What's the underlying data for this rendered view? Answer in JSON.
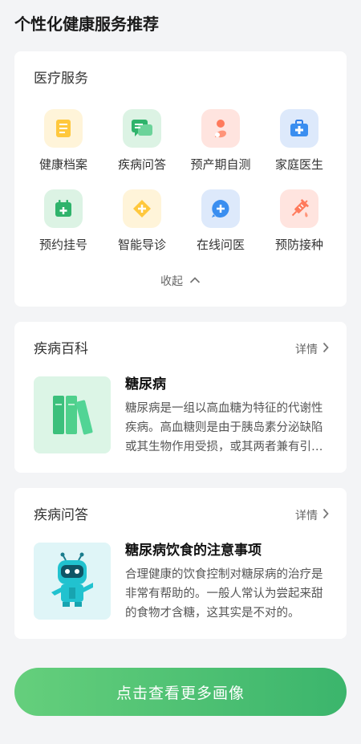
{
  "page": {
    "title": "个性化健康服务推荐"
  },
  "services": {
    "title": "医疗服务",
    "items": [
      {
        "label": "健康档案",
        "icon": "health-record-icon",
        "bg": "#fff4d9"
      },
      {
        "label": "疾病问答",
        "icon": "disease-qa-icon",
        "bg": "#dcf3e4"
      },
      {
        "label": "预产期自测",
        "icon": "due-date-icon",
        "bg": "#ffe4df"
      },
      {
        "label": "家庭医生",
        "icon": "family-doctor-icon",
        "bg": "#dde9fb"
      },
      {
        "label": "预约挂号",
        "icon": "appointment-icon",
        "bg": "#dcf3e4"
      },
      {
        "label": "智能导诊",
        "icon": "smart-guide-icon",
        "bg": "#fff4d9"
      },
      {
        "label": "在线问医",
        "icon": "online-consult-icon",
        "bg": "#dde9fb"
      },
      {
        "label": "预防接种",
        "icon": "vaccine-icon",
        "bg": "#ffe4df"
      }
    ],
    "collapse_label": "收起"
  },
  "baike": {
    "title": "疾病百科",
    "detail": "详情",
    "article_title": "糖尿病",
    "article_desc": "糖尿病是一组以高血糖为特征的代谢性疾病。高血糖则是由于胰岛素分泌缺陷或其生物作用受损，或其两者兼有引起。"
  },
  "qa": {
    "title": "疾病问答",
    "detail": "详情",
    "article_title": "糖尿病饮食的注意事项",
    "article_desc": "合理健康的饮食控制对糖尿病的治疗是非常有帮助的。一般人常认为尝起来甜的食物才含糖，这其实是不对的。"
  },
  "cta": {
    "label": "点击查看更多画像"
  },
  "colors": {
    "accent": "#3bb56c",
    "background": "#f3f4f6"
  }
}
